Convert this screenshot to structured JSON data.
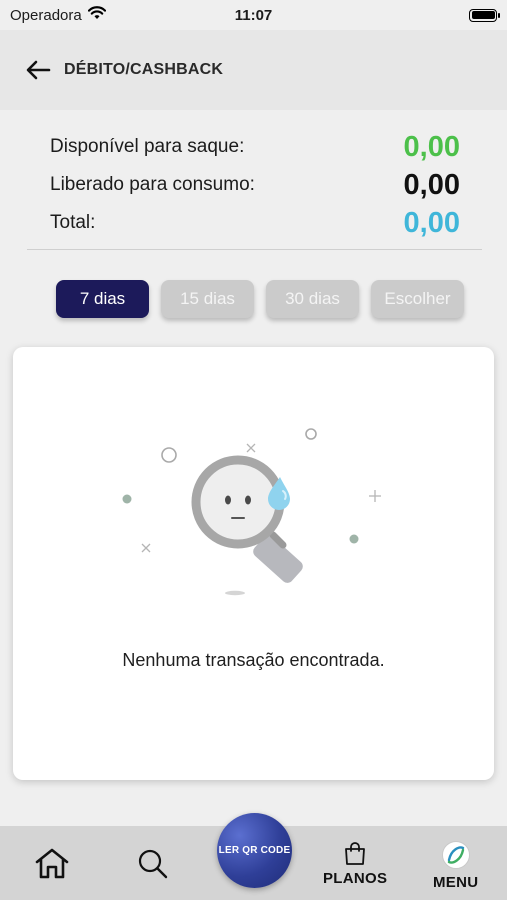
{
  "status_bar": {
    "carrier": "Operadora",
    "time": "11:07"
  },
  "header": {
    "title": "DÉBITO/CASHBACK"
  },
  "balances": [
    {
      "label": "Disponível para saque:",
      "value": "0,00",
      "color": "#4cc04a"
    },
    {
      "label": "Liberado para consumo:",
      "value": "0,00",
      "color": "#111111"
    },
    {
      "label": "Total:",
      "value": "0,00",
      "color": "#3fb6d9"
    }
  ],
  "filters": [
    {
      "label": "7 dias",
      "active": true
    },
    {
      "label": "15 dias",
      "active": false
    },
    {
      "label": "30 dias",
      "active": false
    },
    {
      "label": "Escolher",
      "active": false
    }
  ],
  "empty_state": {
    "message": "Nenhuma transação encontrada."
  },
  "bottom_nav": {
    "home_icon": "home-icon",
    "search_icon": "search-icon",
    "qr_label": "LER QR CODE",
    "plans_label": "PLANOS",
    "menu_label": "MENU"
  },
  "colors": {
    "accent": "#1c1a5a",
    "header_bg": "#e7e7e7",
    "nav_bg": "#d4d4d4"
  }
}
